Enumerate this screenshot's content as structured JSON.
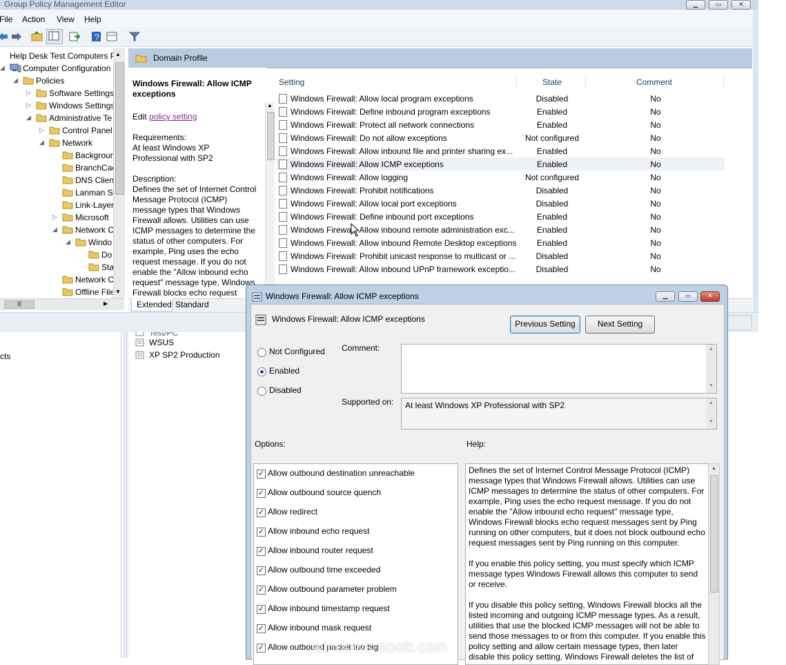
{
  "window": {
    "title": "Group Policy Management Editor"
  },
  "menu": [
    "File",
    "Action",
    "View",
    "Help"
  ],
  "tree": [
    {
      "label": "Help Desk Test Computers P",
      "depth": 0,
      "icon": "gpo-icon"
    },
    {
      "label": "Computer Configuration",
      "depth": 1,
      "icon": "computer-icon"
    },
    {
      "label": "Policies",
      "depth": 2,
      "icon": "folder-icon"
    },
    {
      "label": "Software Settings",
      "depth": 3,
      "icon": "folder-icon"
    },
    {
      "label": "Windows Settings",
      "depth": 3,
      "icon": "folder-icon"
    },
    {
      "label": "Administrative Te",
      "depth": 3,
      "icon": "folder-icon"
    },
    {
      "label": "Control Panel",
      "depth": 4,
      "icon": "folder-icon"
    },
    {
      "label": "Network",
      "depth": 4,
      "icon": "folder-icon"
    },
    {
      "label": "Backgrour",
      "depth": 5,
      "icon": "folder-icon"
    },
    {
      "label": "BranchCac",
      "depth": 5,
      "icon": "folder-icon"
    },
    {
      "label": "DNS Client",
      "depth": 5,
      "icon": "folder-icon"
    },
    {
      "label": "Lanman Se",
      "depth": 5,
      "icon": "folder-icon"
    },
    {
      "label": "Link-Layer",
      "depth": 5,
      "icon": "folder-icon"
    },
    {
      "label": "Microsoft",
      "depth": 5,
      "icon": "folder-icon"
    },
    {
      "label": "Network C",
      "depth": 5,
      "icon": "folder-icon"
    },
    {
      "label": "Windo",
      "depth": 6,
      "icon": "folder-icon"
    },
    {
      "label": "Do",
      "depth": 7,
      "icon": "folder-icon"
    },
    {
      "label": "Sta",
      "depth": 7,
      "icon": "folder-icon"
    },
    {
      "label": "Network C",
      "depth": 5,
      "icon": "folder-icon"
    },
    {
      "label": "Offline File",
      "depth": 5,
      "icon": "folder-icon"
    }
  ],
  "domain_header": "Domain Profile",
  "description": {
    "title": "Windows Firewall: Allow ICMP exceptions",
    "edit_prefix": "Edit ",
    "edit_link": "policy setting ",
    "requirements_label": "Requirements:",
    "requirements_text": "At least Windows XP Professional with SP2",
    "description_label": "Description:",
    "description_text": "Defines the set of Internet Control Message Protocol (ICMP) message types that Windows Firewall allows. Utilities can use ICMP messages to determine the status of other computers. For example, Ping uses the echo request message. If you do not enable the \"Allow inbound echo request\" message type, Windows Firewall blocks echo request"
  },
  "list": {
    "columns": [
      "Setting",
      "State",
      "Comment"
    ],
    "rows": [
      {
        "setting": "Windows Firewall: Allow local program exceptions",
        "state": "Disabled",
        "comment": "No"
      },
      {
        "setting": "Windows Firewall: Define inbound program exceptions",
        "state": "Enabled",
        "comment": "No"
      },
      {
        "setting": "Windows Firewall: Protect all network connections",
        "state": "Enabled",
        "comment": "No"
      },
      {
        "setting": "Windows Firewall: Do not allow exceptions",
        "state": "Not configured",
        "comment": "No"
      },
      {
        "setting": "Windows Firewall: Allow inbound file and printer sharing ex...",
        "state": "Enabled",
        "comment": "No"
      },
      {
        "setting": "Windows Firewall: Allow ICMP exceptions",
        "state": "Enabled",
        "comment": "No"
      },
      {
        "setting": "Windows Firewall: Allow logging",
        "state": "Not configured",
        "comment": "No"
      },
      {
        "setting": "Windows Firewall: Prohibit notifications",
        "state": "Disabled",
        "comment": "No"
      },
      {
        "setting": "Windows Firewall: Allow local port exceptions",
        "state": "Disabled",
        "comment": "No"
      },
      {
        "setting": "Windows Firewall: Define inbound port exceptions",
        "state": "Enabled",
        "comment": "No"
      },
      {
        "setting": "Windows Firewall: Allow inbound remote administration exc...",
        "state": "Enabled",
        "comment": "No"
      },
      {
        "setting": "Windows Firewall: Allow inbound Remote Desktop exceptions",
        "state": "Enabled",
        "comment": "No"
      },
      {
        "setting": "Windows Firewall: Prohibit unicast response to multicast or ...",
        "state": "Disabled",
        "comment": "No"
      },
      {
        "setting": "Windows Firewall: Allow inbound UPnP framework exceptio...",
        "state": "Disabled",
        "comment": "No"
      }
    ]
  },
  "tabs": [
    "Extended",
    "Standard"
  ],
  "background": {
    "left_partial": "cts",
    "list_items": [
      "Test/PC",
      "WSUS",
      "XP SP2 Production"
    ]
  },
  "dialog": {
    "title": "Windows Firewall: Allow ICMP exceptions",
    "header_label": "Windows Firewall: Allow ICMP exceptions",
    "prev_button": "Previous Setting",
    "next_button": "Next Setting",
    "radio_options": [
      "Not Configured",
      "Enabled",
      "Disabled"
    ],
    "comment_label": "Comment:",
    "supported_label": "Supported on:",
    "supported_value": "At least Windows XP Professional with SP2",
    "options_label": "Options:",
    "help_label": "Help:",
    "options": [
      {
        "label": "Allow outbound destination unreachable",
        "checked": true
      },
      {
        "label": "Allow outbound source quench",
        "checked": true
      },
      {
        "label": "Allow redirect",
        "checked": true
      },
      {
        "label": "Allow inbound echo request",
        "checked": true
      },
      {
        "label": "Allow inbound router request",
        "checked": true
      },
      {
        "label": "Allow outbound time exceeded",
        "checked": true
      },
      {
        "label": "Allow outbound parameter problem",
        "checked": true
      },
      {
        "label": "Allow inbound timestamp request",
        "checked": true
      },
      {
        "label": "Allow inbound mask request",
        "checked": true
      },
      {
        "label": "Allow outbound packet too big",
        "checked": true
      }
    ],
    "help_paragraphs": [
      "Defines the set of Internet Control Message Protocol (ICMP) message types that Windows Firewall allows. Utilities can use ICMP messages to determine the status of other computers. For example, Ping uses the echo request message. If you do not enable the \"Allow inbound echo request\" message type, Windows Firewall blocks echo request messages sent by Ping running on other computers, but it does not block outbound echo request messages sent by Ping running on this computer.",
      "If you enable this policy setting, you must specify which ICMP message types Windows Firewall allows this computer to send or receive.",
      "If you disable this policy setting, Windows Firewall blocks all the listed incoming and outgoing ICMP message types. As a result, utilities that use the blocked ICMP messages will not be able to send those messages to or from this computer. If you enable this policy setting and allow certain message types, then later disable this policy setting, Windows Firewall deletes the list of message"
    ]
  },
  "watermark": "windows-noob.com",
  "colors": {
    "header_bg": "#b8cde0",
    "selected_row": "#eef2f7",
    "link": "#7b2c8a",
    "dialog_frame": "#bfd1e4"
  }
}
